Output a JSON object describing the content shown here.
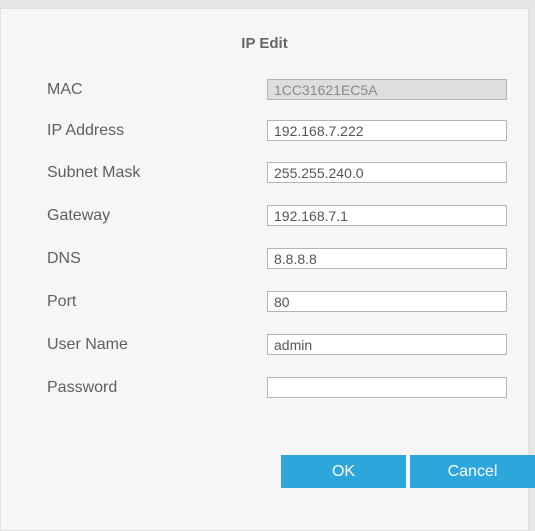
{
  "dialog": {
    "title": "IP Edit",
    "fields": [
      {
        "label": "MAC",
        "value": "1CC31621EC5A",
        "readonly": true
      },
      {
        "label": "IP Address",
        "value": "192.168.7.222",
        "readonly": false
      },
      {
        "label": "Subnet Mask",
        "value": "255.255.240.0",
        "readonly": false
      },
      {
        "label": "Gateway",
        "value": "192.168.7.1",
        "readonly": false
      },
      {
        "label": "DNS",
        "value": "8.8.8.8",
        "readonly": false
      },
      {
        "label": "Port",
        "value": "80",
        "readonly": false
      },
      {
        "label": "User Name",
        "value": "admin",
        "readonly": false
      },
      {
        "label": "Password",
        "value": "",
        "readonly": false
      }
    ],
    "ok_label": "OK",
    "cancel_label": "Cancel"
  },
  "colors": {
    "accent": "#2da6dc",
    "background": "#f6f6f6",
    "readonly_field": "#dedede"
  }
}
